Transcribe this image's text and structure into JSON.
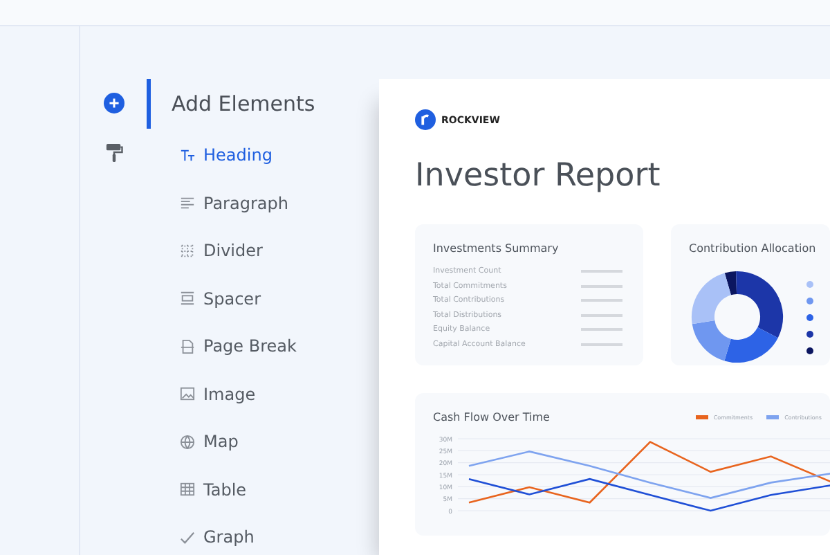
{
  "panel": {
    "title": "Add Elements",
    "items": [
      {
        "label": "Heading",
        "selected": true
      },
      {
        "label": "Paragraph",
        "selected": false
      },
      {
        "label": "Divider",
        "selected": false
      },
      {
        "label": "Spacer",
        "selected": false
      },
      {
        "label": "Page Break",
        "selected": false
      },
      {
        "label": "Image",
        "selected": false
      },
      {
        "label": "Map",
        "selected": false
      },
      {
        "label": "Table",
        "selected": false
      },
      {
        "label": "Graph",
        "selected": false
      }
    ]
  },
  "report": {
    "brand": "ROCKVIEW",
    "title": "Investor Report",
    "summary": {
      "title": "Investments Summary",
      "rows": [
        "Investment Count",
        "Total Commitments",
        "Total Contributions",
        "Total Distributions",
        "Equity Balance",
        "Capital Account Balance"
      ]
    },
    "allocation": {
      "title": "Contribution Allocation",
      "legend": [
        {
          "color": "#a9c1f7"
        },
        {
          "color": "#6f97f0"
        },
        {
          "color": "#2d63e6"
        },
        {
          "color": "#1c36a8"
        },
        {
          "color": "#0b1660"
        }
      ]
    },
    "cash_flow": {
      "title": "Cash Flow Over Time",
      "chart_data": {
        "type": "line",
        "grid": true,
        "yticks": [
          {
            "value": 0,
            "label": "0"
          },
          {
            "value": 5,
            "label": "5M"
          },
          {
            "value": 10,
            "label": "10M"
          },
          {
            "value": 15,
            "label": "15M"
          },
          {
            "value": 20,
            "label": "20M"
          },
          {
            "value": 25,
            "label": "25M"
          },
          {
            "value": 30,
            "label": "30M"
          }
        ],
        "ylim": [
          0,
          30
        ],
        "series": [
          {
            "name": "Commitments",
            "color": "#e8641e",
            "values": [
              3.4,
              9.8,
              3.4,
              28.7,
              16.2,
              22.6,
              12
            ]
          },
          {
            "name": "Contributions",
            "color": "#7ea3ef",
            "values": [
              18.7,
              24.7,
              18.7,
              11.7,
              5.3,
              11.7,
              15.5
            ]
          },
          {
            "color": "#1f4fd6",
            "values": [
              13.2,
              6.8,
              13.2,
              6.6,
              0,
              6.6,
              10.6
            ]
          }
        ]
      }
    }
  }
}
